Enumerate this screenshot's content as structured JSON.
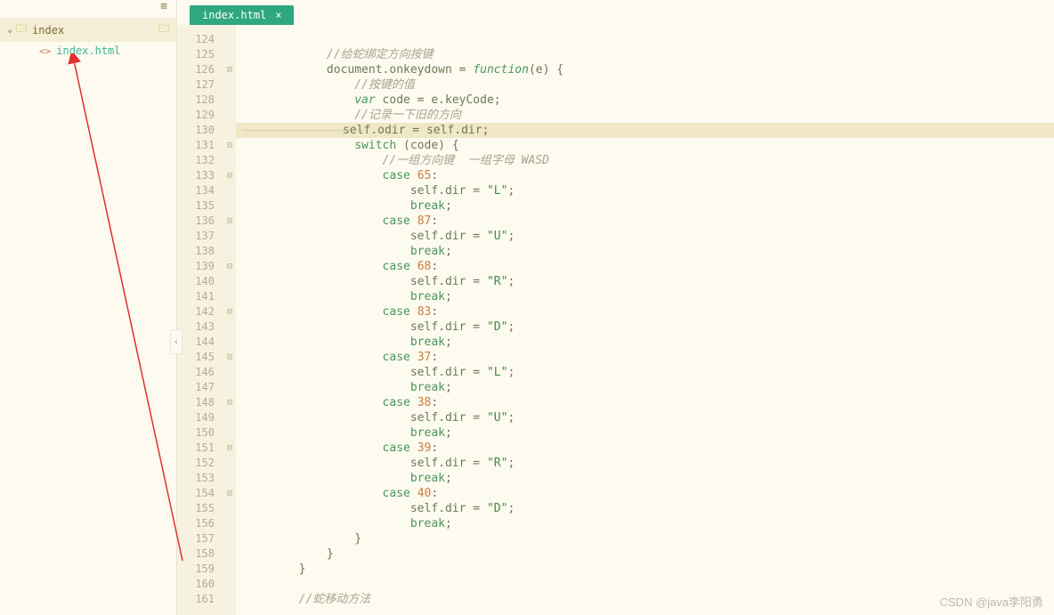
{
  "sidebar": {
    "folder_name": "index",
    "file_name": "index.html"
  },
  "tab": {
    "label": "index.html"
  },
  "gutter": {
    "start": 124,
    "end": 161,
    "fold_lines": [
      126,
      131,
      133,
      136,
      139,
      142,
      145,
      148,
      151,
      154
    ]
  },
  "code": [
    {
      "n": 124,
      "ind": 3,
      "t": []
    },
    {
      "n": 125,
      "ind": 3,
      "t": [
        {
          "c": "cm",
          "s": "//给蛇绑定方向按键"
        }
      ]
    },
    {
      "n": 126,
      "ind": 3,
      "t": [
        {
          "c": "id",
          "s": "document"
        },
        {
          "c": "op",
          "s": "."
        },
        {
          "c": "id",
          "s": "onkeydown"
        },
        {
          "c": "op",
          "s": " = "
        },
        {
          "c": "fn",
          "s": "function"
        },
        {
          "c": "op",
          "s": "(e) {"
        }
      ]
    },
    {
      "n": 127,
      "ind": 4,
      "t": [
        {
          "c": "cm",
          "s": "//按键的值"
        }
      ]
    },
    {
      "n": 128,
      "ind": 4,
      "t": [
        {
          "c": "kw",
          "s": "var"
        },
        {
          "c": "op",
          "s": " "
        },
        {
          "c": "id",
          "s": "code"
        },
        {
          "c": "op",
          "s": " = "
        },
        {
          "c": "id",
          "s": "e"
        },
        {
          "c": "op",
          "s": "."
        },
        {
          "c": "id",
          "s": "keyCode"
        },
        {
          "c": "op",
          "s": ";"
        }
      ]
    },
    {
      "n": 129,
      "ind": 4,
      "t": [
        {
          "c": "cm",
          "s": "//记录一下旧的方向"
        }
      ]
    },
    {
      "n": 130,
      "ind": 4,
      "hl": true,
      "t": [
        {
          "c": "id",
          "s": "self"
        },
        {
          "c": "op",
          "s": "."
        },
        {
          "c": "id",
          "s": "odir"
        },
        {
          "c": "op",
          "s": " = "
        },
        {
          "c": "id",
          "s": "self"
        },
        {
          "c": "op",
          "s": "."
        },
        {
          "c": "id",
          "s": "dir"
        },
        {
          "c": "op",
          "s": ";"
        }
      ]
    },
    {
      "n": 131,
      "ind": 4,
      "t": [
        {
          "c": "kw2",
          "s": "switch"
        },
        {
          "c": "op",
          "s": " (code) {"
        }
      ]
    },
    {
      "n": 132,
      "ind": 5,
      "t": [
        {
          "c": "cm",
          "s": "//一组方向键  一组字母 WASD"
        }
      ]
    },
    {
      "n": 133,
      "ind": 5,
      "t": [
        {
          "c": "kw2",
          "s": "case"
        },
        {
          "c": "op",
          "s": " "
        },
        {
          "c": "num",
          "s": "65"
        },
        {
          "c": "op",
          "s": ":"
        }
      ]
    },
    {
      "n": 134,
      "ind": 6,
      "t": [
        {
          "c": "id",
          "s": "self"
        },
        {
          "c": "op",
          "s": "."
        },
        {
          "c": "id",
          "s": "dir"
        },
        {
          "c": "op",
          "s": " = "
        },
        {
          "c": "str",
          "s": "\"L\""
        },
        {
          "c": "op",
          "s": ";"
        }
      ]
    },
    {
      "n": 135,
      "ind": 6,
      "t": [
        {
          "c": "kw2",
          "s": "break"
        },
        {
          "c": "op",
          "s": ";"
        }
      ]
    },
    {
      "n": 136,
      "ind": 5,
      "t": [
        {
          "c": "kw2",
          "s": "case"
        },
        {
          "c": "op",
          "s": " "
        },
        {
          "c": "num",
          "s": "87"
        },
        {
          "c": "op",
          "s": ":"
        }
      ]
    },
    {
      "n": 137,
      "ind": 6,
      "t": [
        {
          "c": "id",
          "s": "self"
        },
        {
          "c": "op",
          "s": "."
        },
        {
          "c": "id",
          "s": "dir"
        },
        {
          "c": "op",
          "s": " = "
        },
        {
          "c": "str",
          "s": "\"U\""
        },
        {
          "c": "op",
          "s": ";"
        }
      ]
    },
    {
      "n": 138,
      "ind": 6,
      "t": [
        {
          "c": "kw2",
          "s": "break"
        },
        {
          "c": "op",
          "s": ";"
        }
      ]
    },
    {
      "n": 139,
      "ind": 5,
      "t": [
        {
          "c": "kw2",
          "s": "case"
        },
        {
          "c": "op",
          "s": " "
        },
        {
          "c": "num",
          "s": "68"
        },
        {
          "c": "op",
          "s": ":"
        }
      ]
    },
    {
      "n": 140,
      "ind": 6,
      "t": [
        {
          "c": "id",
          "s": "self"
        },
        {
          "c": "op",
          "s": "."
        },
        {
          "c": "id",
          "s": "dir"
        },
        {
          "c": "op",
          "s": " = "
        },
        {
          "c": "str",
          "s": "\"R\""
        },
        {
          "c": "op",
          "s": ";"
        }
      ]
    },
    {
      "n": 141,
      "ind": 6,
      "t": [
        {
          "c": "kw2",
          "s": "break"
        },
        {
          "c": "op",
          "s": ";"
        }
      ]
    },
    {
      "n": 142,
      "ind": 5,
      "t": [
        {
          "c": "kw2",
          "s": "case"
        },
        {
          "c": "op",
          "s": " "
        },
        {
          "c": "num",
          "s": "83"
        },
        {
          "c": "op",
          "s": ":"
        }
      ]
    },
    {
      "n": 143,
      "ind": 6,
      "t": [
        {
          "c": "id",
          "s": "self"
        },
        {
          "c": "op",
          "s": "."
        },
        {
          "c": "id",
          "s": "dir"
        },
        {
          "c": "op",
          "s": " = "
        },
        {
          "c": "str",
          "s": "\"D\""
        },
        {
          "c": "op",
          "s": ";"
        }
      ]
    },
    {
      "n": 144,
      "ind": 6,
      "t": [
        {
          "c": "kw2",
          "s": "break"
        },
        {
          "c": "op",
          "s": ";"
        }
      ]
    },
    {
      "n": 145,
      "ind": 5,
      "t": [
        {
          "c": "kw2",
          "s": "case"
        },
        {
          "c": "op",
          "s": " "
        },
        {
          "c": "num",
          "s": "37"
        },
        {
          "c": "op",
          "s": ":"
        }
      ]
    },
    {
      "n": 146,
      "ind": 6,
      "t": [
        {
          "c": "id",
          "s": "self"
        },
        {
          "c": "op",
          "s": "."
        },
        {
          "c": "id",
          "s": "dir"
        },
        {
          "c": "op",
          "s": " = "
        },
        {
          "c": "str",
          "s": "\"L\""
        },
        {
          "c": "op",
          "s": ";"
        }
      ]
    },
    {
      "n": 147,
      "ind": 6,
      "t": [
        {
          "c": "kw2",
          "s": "break"
        },
        {
          "c": "op",
          "s": ";"
        }
      ]
    },
    {
      "n": 148,
      "ind": 5,
      "t": [
        {
          "c": "kw2",
          "s": "case"
        },
        {
          "c": "op",
          "s": " "
        },
        {
          "c": "num",
          "s": "38"
        },
        {
          "c": "op",
          "s": ":"
        }
      ]
    },
    {
      "n": 149,
      "ind": 6,
      "t": [
        {
          "c": "id",
          "s": "self"
        },
        {
          "c": "op",
          "s": "."
        },
        {
          "c": "id",
          "s": "dir"
        },
        {
          "c": "op",
          "s": " = "
        },
        {
          "c": "str",
          "s": "\"U\""
        },
        {
          "c": "op",
          "s": ";"
        }
      ]
    },
    {
      "n": 150,
      "ind": 6,
      "t": [
        {
          "c": "kw2",
          "s": "break"
        },
        {
          "c": "op",
          "s": ";"
        }
      ]
    },
    {
      "n": 151,
      "ind": 5,
      "t": [
        {
          "c": "kw2",
          "s": "case"
        },
        {
          "c": "op",
          "s": " "
        },
        {
          "c": "num",
          "s": "39"
        },
        {
          "c": "op",
          "s": ":"
        }
      ]
    },
    {
      "n": 152,
      "ind": 6,
      "t": [
        {
          "c": "id",
          "s": "self"
        },
        {
          "c": "op",
          "s": "."
        },
        {
          "c": "id",
          "s": "dir"
        },
        {
          "c": "op",
          "s": " = "
        },
        {
          "c": "str",
          "s": "\"R\""
        },
        {
          "c": "op",
          "s": ";"
        }
      ]
    },
    {
      "n": 153,
      "ind": 6,
      "t": [
        {
          "c": "kw2",
          "s": "break"
        },
        {
          "c": "op",
          "s": ";"
        }
      ]
    },
    {
      "n": 154,
      "ind": 5,
      "t": [
        {
          "c": "kw2",
          "s": "case"
        },
        {
          "c": "op",
          "s": " "
        },
        {
          "c": "num",
          "s": "40"
        },
        {
          "c": "op",
          "s": ":"
        }
      ]
    },
    {
      "n": 155,
      "ind": 6,
      "t": [
        {
          "c": "id",
          "s": "self"
        },
        {
          "c": "op",
          "s": "."
        },
        {
          "c": "id",
          "s": "dir"
        },
        {
          "c": "op",
          "s": " = "
        },
        {
          "c": "str",
          "s": "\"D\""
        },
        {
          "c": "op",
          "s": ";"
        }
      ]
    },
    {
      "n": 156,
      "ind": 6,
      "t": [
        {
          "c": "kw2",
          "s": "break"
        },
        {
          "c": "op",
          "s": ";"
        }
      ]
    },
    {
      "n": 157,
      "ind": 4,
      "t": [
        {
          "c": "op",
          "s": "}"
        }
      ]
    },
    {
      "n": 158,
      "ind": 3,
      "t": [
        {
          "c": "op",
          "s": "}"
        }
      ]
    },
    {
      "n": 159,
      "ind": 2,
      "t": [
        {
          "c": "op",
          "s": "}"
        }
      ]
    },
    {
      "n": 160,
      "ind": 2,
      "t": []
    },
    {
      "n": 161,
      "ind": 2,
      "t": [
        {
          "c": "cm",
          "s": "//蛇移动方法"
        }
      ]
    }
  ],
  "watermark": "CSDN @java李阳勇"
}
